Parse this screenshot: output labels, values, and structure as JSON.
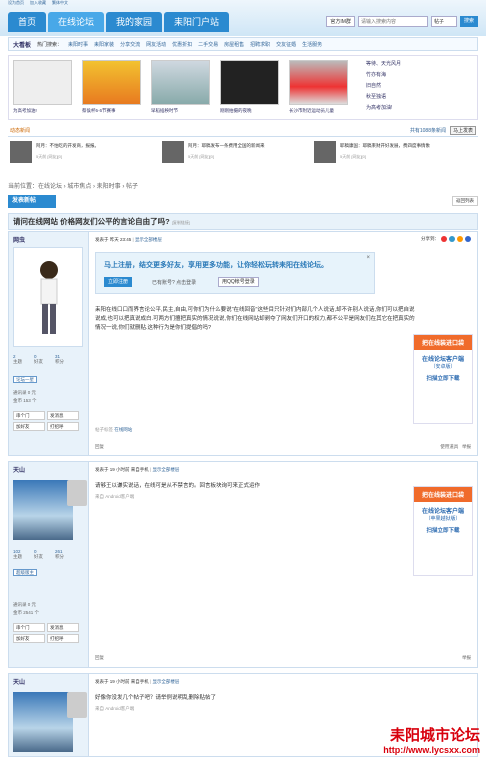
{
  "toplinks": [
    "设为首页",
    "加入收藏",
    "繁体中文"
  ],
  "nav": [
    "首页",
    "在线论坛",
    "我的家园",
    "耒阳门户站"
  ],
  "search": {
    "logo": "官方IM群",
    "placeholder": "请输入搜索内容",
    "scope": "帖子",
    "button": "搜索"
  },
  "bar": {
    "title": "大看板",
    "hot": "热门搜索：",
    "items": [
      "耒阳时事",
      "耒阳家装",
      "分享交流",
      "网友活动",
      "优惠折扣",
      "二手交易",
      "房屋租售",
      "招聘求职",
      "交友征婚",
      "生活服务"
    ]
  },
  "pics": [
    "为高考加油!",
    "蔡侯杯5·6节赛事",
    "早稻插秧时节",
    "刚刚拍摄的夜晚",
    "长沙市附近运动员儿童"
  ],
  "side_list": [
    "等待、天光风月",
    "竹亦有海",
    "旧自然",
    "秋至独语",
    "为高考加油!"
  ],
  "row2": {
    "title": "动态新闻",
    "more": "共有1088条新闻",
    "btn": "马上发表"
  },
  "news": [
    {
      "t": "阿月：不怕吃的开发商，报报。",
      "tm": "5天前 [网友][0]"
    },
    {
      "t": "阿月：耶稿发布一条费用全国的新闻来",
      "tm": "5天前 [网友][0]"
    },
    {
      "t": "耶稿康国：耶稿耒财开好发展，费四度事情象",
      "tm": "5天前 [网友][0]"
    }
  ],
  "crumb": "当前位置：在线论坛 › 城市焦点 › 耒阳时事 › 帖子",
  "post_btn": "发表新帖",
  "back": "返回列表",
  "thread_title": "请问在线网站 价格网友们公平的言论自由了吗?",
  "thread_tag": "[复制链接]",
  "p1": {
    "user": "网虫",
    "time": "发表于 昨天 23:45",
    "only": "显示全部楼层",
    "share": "分享到：",
    "stats": [
      "2",
      "0",
      "31"
    ],
    "labels": [
      "主题",
      "好友",
      "积分"
    ],
    "rank": "论坛一星",
    "meta1": "通讯录",
    "meta1v": "0 元",
    "meta2": "金币",
    "meta2v": "153 个",
    "btns": [
      "串个门",
      "发消息",
      "加好友",
      "打招呼"
    ],
    "reg": "马上注册，结交更多好友，享用更多功能，让你轻松玩转耒阳在线论坛。",
    "reg_btn": "立即注册",
    "reg_q": "已有账号? 点击登录",
    "reg_qq": "用QQ帐号登录",
    "body": "耒阳在线口口而界言论公平,民主,自由,可你们为什么要说\"在线回音\"这些目只针对们内部几个人说话,却不许别人说话,你们可以把自说说成,也可以把真说成白.可两方们擅把真实的情况说说,你们在线网站却剥夺了网友们开口的权力,都不公平是网友们在其它在把真实的情况一说,你们就删贴.这种行为是你们提倡的吗?",
    "tag": "帖子标签",
    "tagv": "在线网站",
    "reply": "回复",
    "tools": "使用道具",
    "report": "举报"
  },
  "ad": {
    "h": "把在线装进口袋",
    "c": "在线论坛客户端",
    "s1": "（安卓版）",
    "s2": "（苹果越狱版）",
    "dl": "扫描立即下载"
  },
  "p2": {
    "user": "天山",
    "time": "发表于 19 小时前 来自手机",
    "only": "显示全部楼层",
    "stats": [
      "102",
      "0",
      "261"
    ],
    "labels": [
      "主题",
      "好友",
      "积分"
    ],
    "rank": "超级版主",
    "meta1": "通讯录",
    "meta1v": "0 元",
    "meta2": "金币",
    "meta2v": "2541 个",
    "btns": [
      "串个门",
      "发消息",
      "加好友",
      "打招呼"
    ],
    "body": "请够王以谦实说话，在线可是从不禁言的。回言板块询可来正式运作",
    "src": "来自 Android客户端",
    "reply": "回复",
    "report": "举报"
  },
  "p3": {
    "user": "天山",
    "time": "发表于 19 小时前 来自手机",
    "only": "显示全部楼层",
    "body": "好像你没发几个帖子吧？请举例说明乱删除贴帖了",
    "src": "来自 Android客户端"
  },
  "watermark": {
    "a": "耒阳城市论坛",
    "b": "http://www.lycsxx.com"
  }
}
